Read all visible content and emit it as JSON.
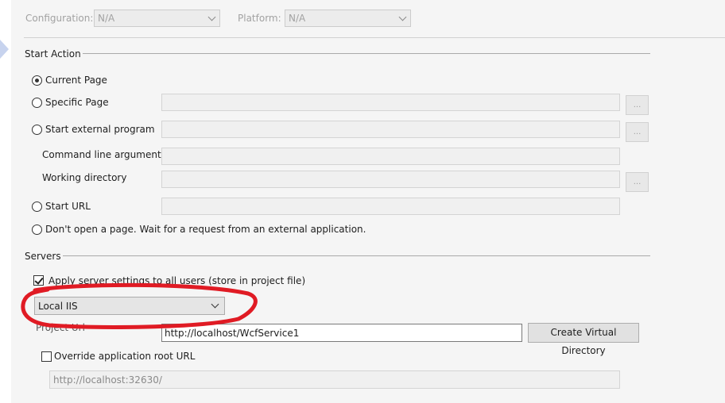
{
  "header": {
    "configuration_label": "Configuration:",
    "configuration_value": "N/A",
    "platform_label": "Platform:",
    "platform_value": "N/A"
  },
  "start_action": {
    "title": "Start Action",
    "current_page": "Current Page",
    "specific_page": "Specific Page",
    "start_external_program": "Start external program",
    "command_line_arguments": "Command line arguments",
    "working_directory": "Working directory",
    "start_url": "Start URL",
    "dont_open": "Don't open a page.  Wait for a request from an external application.",
    "browse_label": "..."
  },
  "servers": {
    "title": "Servers",
    "apply_settings": "Apply server settings to all users (store in project file)",
    "server_select": "Local IIS",
    "project_url_label": "Project Url",
    "project_url_value": "http://localhost/WcfService1",
    "create_vdir_button": "Create Virtual Directory",
    "override_root": "Override application root URL",
    "override_url_value": "http://localhost:32630/"
  },
  "colors": {
    "annotation_red": "#e01b24",
    "panel_bg": "#f5f5f5"
  }
}
